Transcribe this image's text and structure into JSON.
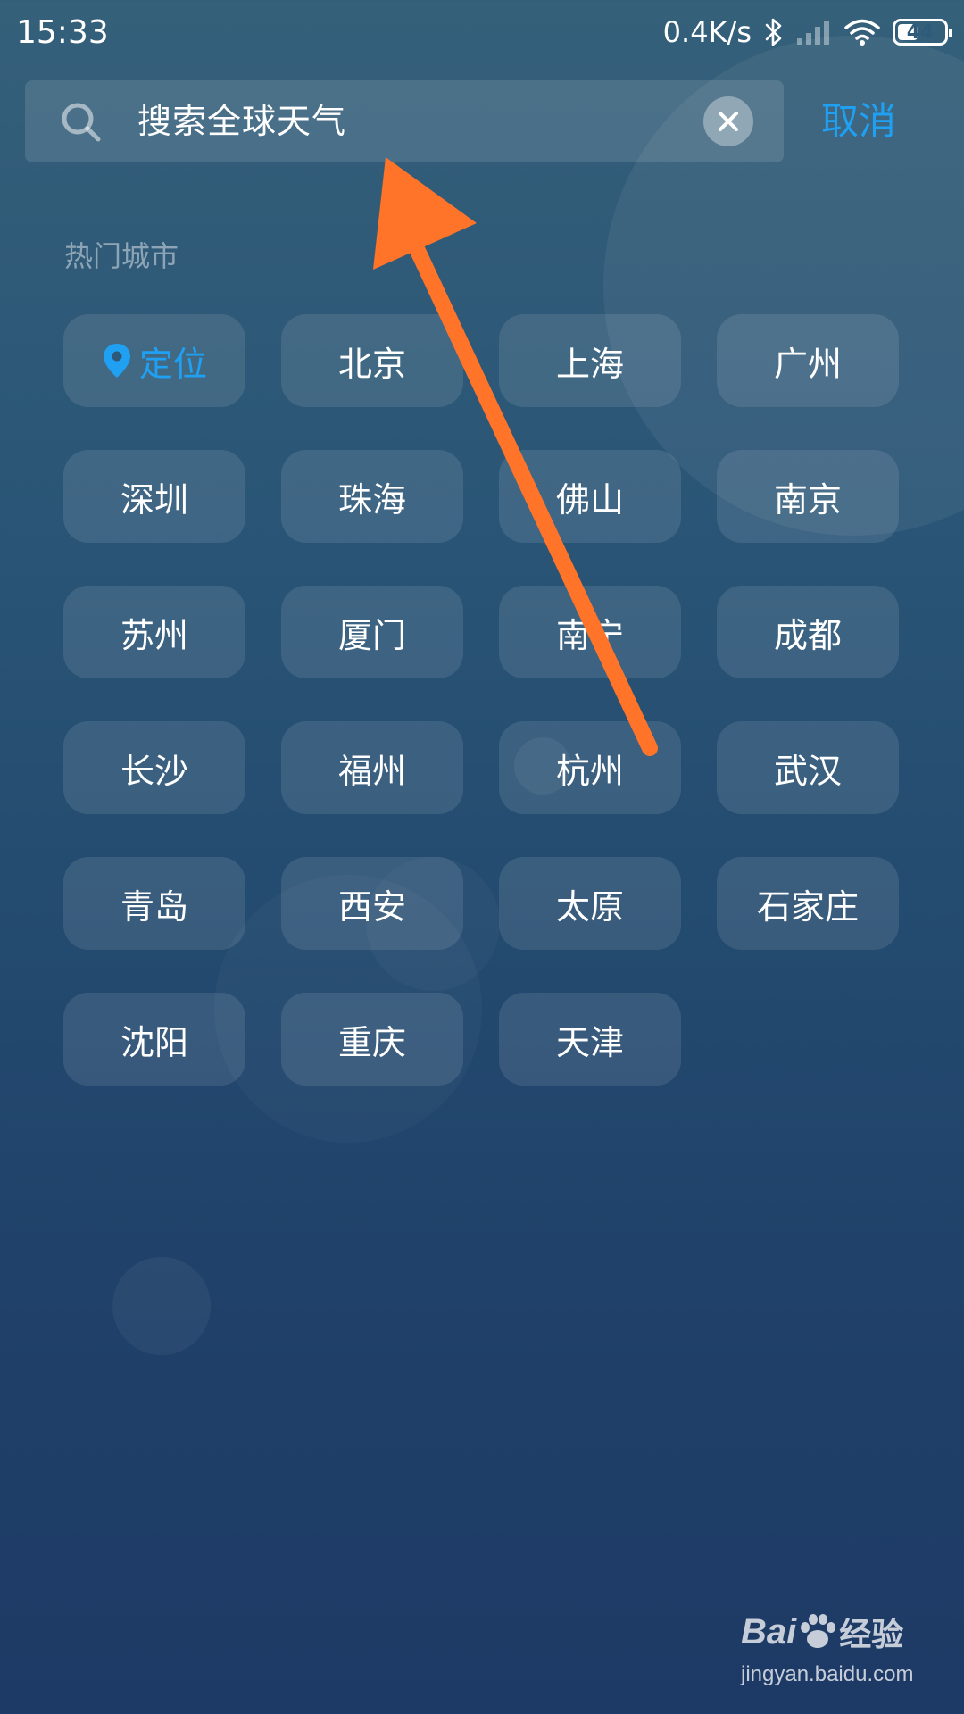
{
  "status_bar": {
    "time": "15:33",
    "net_speed": "0.4K/s",
    "battery_level": "44",
    "battery_fraction": 0.44,
    "icons": [
      "bluetooth-icon",
      "signal-icon",
      "wifi-icon",
      "battery-icon"
    ]
  },
  "search": {
    "placeholder": "搜索全球天气",
    "icon": "search-icon",
    "clear_icon": "close-icon",
    "cancel_label": "取消"
  },
  "section_title": "热门城市",
  "locate": {
    "label": "定位",
    "icon": "location-pin-icon"
  },
  "cities": [
    "北京",
    "上海",
    "广州",
    "深圳",
    "珠海",
    "佛山",
    "南京",
    "苏州",
    "厦门",
    "南宁",
    "成都",
    "长沙",
    "福州",
    "杭州",
    "武汉",
    "青岛",
    "西安",
    "太原",
    "石家庄",
    "沈阳",
    "重庆",
    "天津"
  ],
  "watermark": {
    "brand_a": "Bai",
    "brand_b": "经验",
    "url": "jingyan.baidu.com"
  },
  "colors": {
    "accent": "#1fa0f2",
    "arrow": "#ff7428",
    "bg_top": "#35607a",
    "bg_bottom": "#1d3a66"
  }
}
